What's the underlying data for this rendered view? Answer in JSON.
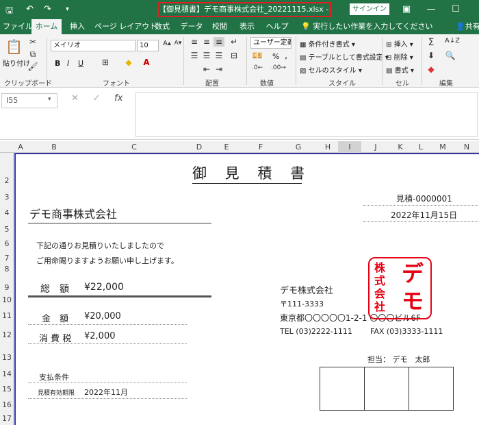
{
  "window": {
    "title": "【御見積書】デモ商事株式会社_20221115.xlsx  -  Excel",
    "signin_label": "サインイン"
  },
  "tabs": [
    "ファイル",
    "ホーム",
    "挿入",
    "ページ レイアウト",
    "数式",
    "データ",
    "校閲",
    "表示",
    "ヘルプ"
  ],
  "active_tab": "ホーム",
  "tell_me": "実行したい作業を入力してください",
  "share_label": "共有",
  "ribbon": {
    "clipboard": {
      "paste": "貼り付け",
      "label": "クリップボード"
    },
    "font": {
      "name": "メイリオ",
      "size": "10",
      "bold": "B",
      "italic": "I",
      "underline": "U",
      "label": "フォント"
    },
    "alignment": {
      "label": "配置"
    },
    "number": {
      "format": "ユーザー定義",
      "percent": "%",
      "comma": ",",
      "label": "数値"
    },
    "styles": {
      "conditional": "条件付き書式",
      "table": "テーブルとして書式設定",
      "cell": "セルのスタイル",
      "label": "スタイル"
    },
    "cells": {
      "insert": "挿入",
      "delete": "削除",
      "format": "書式",
      "label": "セル"
    },
    "editing": {
      "label": "編集"
    }
  },
  "formula_bar": {
    "name_box": "I55",
    "cancel": "✕",
    "enter": "✓",
    "fx": "fx",
    "value": ""
  },
  "columns": [
    "A",
    "B",
    "C",
    "D",
    "E",
    "F",
    "G",
    "H",
    "I",
    "J",
    "K",
    "L",
    "M",
    "N"
  ],
  "rows": [
    "2",
    "3",
    "4",
    "5",
    "6",
    "7",
    "8",
    "9",
    "10",
    "11",
    "12",
    "13",
    "14",
    "15",
    "16",
    "17"
  ],
  "doc": {
    "heading": "御 見 積 書",
    "estimate_no": "見積-0000001",
    "date": "2022年11月15日",
    "client": "デモ商事株式会社",
    "line1": "下記の通りお見積りいたしましたので",
    "line2": "ご用命賜りますようお願い申し上げます。",
    "total_label": "総　額",
    "total_value": "¥22,000",
    "amount_label": "金　額",
    "amount_value": "¥20,000",
    "tax_label": "消 費 税",
    "tax_value": "¥2,000",
    "payment_label": "支払条件",
    "validity_label": "見積有効期限",
    "validity_value": "2022年11月",
    "company": "デモ株式会社",
    "zip": "〒111-3333",
    "address": "東京都〇〇〇〇〇1-2-1  〇〇〇ビル6F",
    "tel": "TEL (03)2222-1111",
    "fax": "FAX (03)3333-1111",
    "contact": "担当：  デモ　太郎",
    "stamp_small": "株式会社",
    "stamp_large": "デモ"
  }
}
